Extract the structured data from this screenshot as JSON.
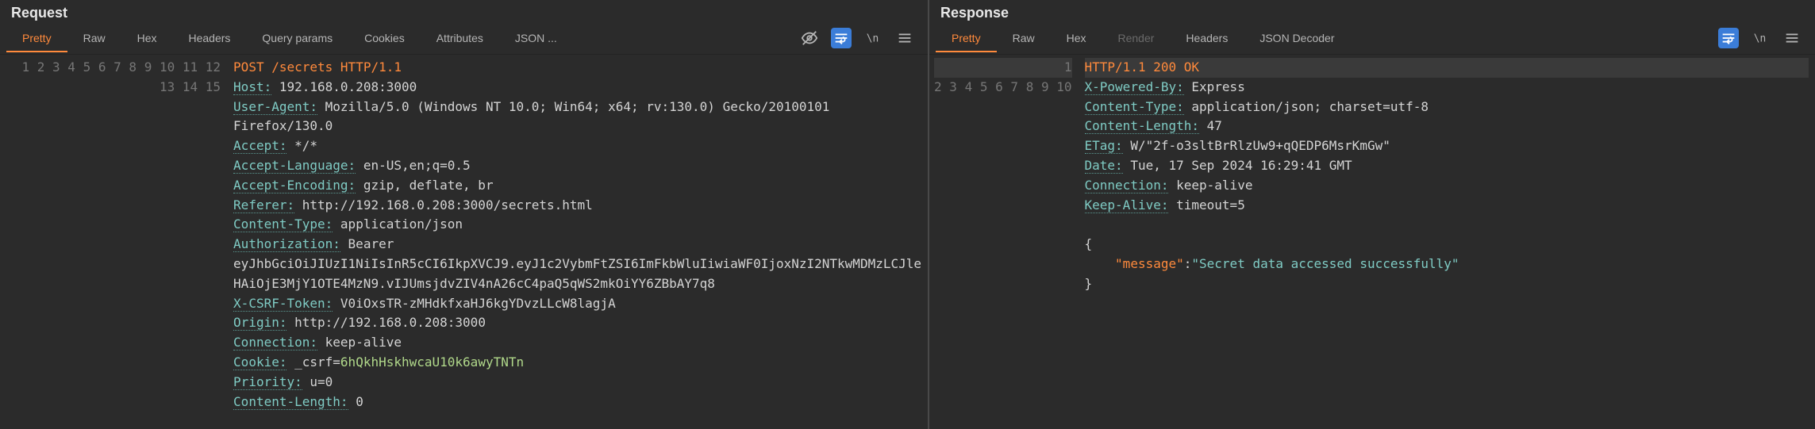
{
  "request": {
    "title": "Request",
    "tabs": {
      "pretty": "Pretty",
      "raw": "Raw",
      "hex": "Hex",
      "headers": "Headers",
      "query_params": "Query params",
      "cookies": "Cookies",
      "attributes": "Attributes",
      "json_trunc": "JSON ..."
    },
    "http": {
      "method": "POST",
      "path": "/secrets",
      "protocol": "HTTP/1.1",
      "headers": {
        "host_key": "Host:",
        "host_val": "192.168.0.208:3000",
        "ua_key": "User-Agent:",
        "ua_val_a": "Mozilla/5.0 (Windows NT 10.0; Win64; x64; rv:130.0) Gecko/20100101",
        "ua_val_b": "Firefox/130.0",
        "accept_key": "Accept:",
        "accept_val": "*/*",
        "alang_key": "Accept-Language:",
        "alang_val": "en-US,en;q=0.5",
        "aenc_key": "Accept-Encoding:",
        "aenc_val": "gzip, deflate, br",
        "ref_key": "Referer:",
        "ref_val": "http://192.168.0.208:3000/secrets.html",
        "ctype_key": "Content-Type:",
        "ctype_val": "application/json",
        "auth_key": "Authorization:",
        "auth_val_a": "Bearer",
        "auth_val_b": "eyJhbGciOiJIUzI1NiIsInR5cCI6IkpXVCJ9.eyJ1c2VybmFtZSI6ImFkbWluIiwiaWF0IjoxNzI2NTkwMDMzLCJle",
        "auth_val_c": "HAiOjE3MjY1OTE4MzN9.vIJUmsjdvZIV4nA26cC4paQ5qWS2mkOiYY6ZBbAY7q8",
        "csrf_key": "X-CSRF-Token:",
        "csrf_val": "V0iOxsTR-zMHdkfxaHJ6kgYDvzLLcW8lagjA",
        "origin_key": "Origin:",
        "origin_val": "http://192.168.0.208:3000",
        "conn_key": "Connection:",
        "conn_val": "keep-alive",
        "cookie_key": "Cookie:",
        "cookie_name": "_csrf=",
        "cookie_val": "6hQkhHskhwcaU10k6awyTNTn",
        "prio_key": "Priority:",
        "prio_val": "u=0",
        "clen_key": "Content-Length:",
        "clen_val": "0"
      }
    },
    "line_numbers": [
      "1",
      "2",
      "3",
      "",
      "4",
      "5",
      "6",
      "7",
      "8",
      "9",
      "",
      "",
      "10",
      "11",
      "12",
      "13",
      "14",
      "15"
    ]
  },
  "response": {
    "title": "Response",
    "tabs": {
      "pretty": "Pretty",
      "raw": "Raw",
      "hex": "Hex",
      "render": "Render",
      "headers": "Headers",
      "json_decoder": "JSON Decoder"
    },
    "http": {
      "status_line": "HTTP/1.1 200 OK",
      "headers": {
        "xpb_key": "X-Powered-By:",
        "xpb_val": "Express",
        "ctype_key": "Content-Type:",
        "ctype_val": "application/json; charset=utf-8",
        "clen_key": "Content-Length:",
        "clen_val": "47",
        "etag_key": "ETag:",
        "etag_val": "W/\"2f-o3sltBrRlzUw9+qQEDP6MsrKmGw\"",
        "date_key": "Date:",
        "date_val": "Tue, 17 Sep 2024 16:29:41 GMT",
        "conn_key": "Connection:",
        "conn_val": "keep-alive",
        "ka_key": "Keep-Alive:",
        "ka_val": "timeout=5"
      },
      "body": {
        "open": "{",
        "indent": "    ",
        "msg_key": "\"message\"",
        "colon": ":",
        "msg_val": "\"Secret data accessed successfully\"",
        "close": "}"
      }
    },
    "line_numbers": [
      "1",
      "2",
      "3",
      "4",
      "5",
      "6",
      "7",
      "8",
      "9",
      "10"
    ]
  }
}
